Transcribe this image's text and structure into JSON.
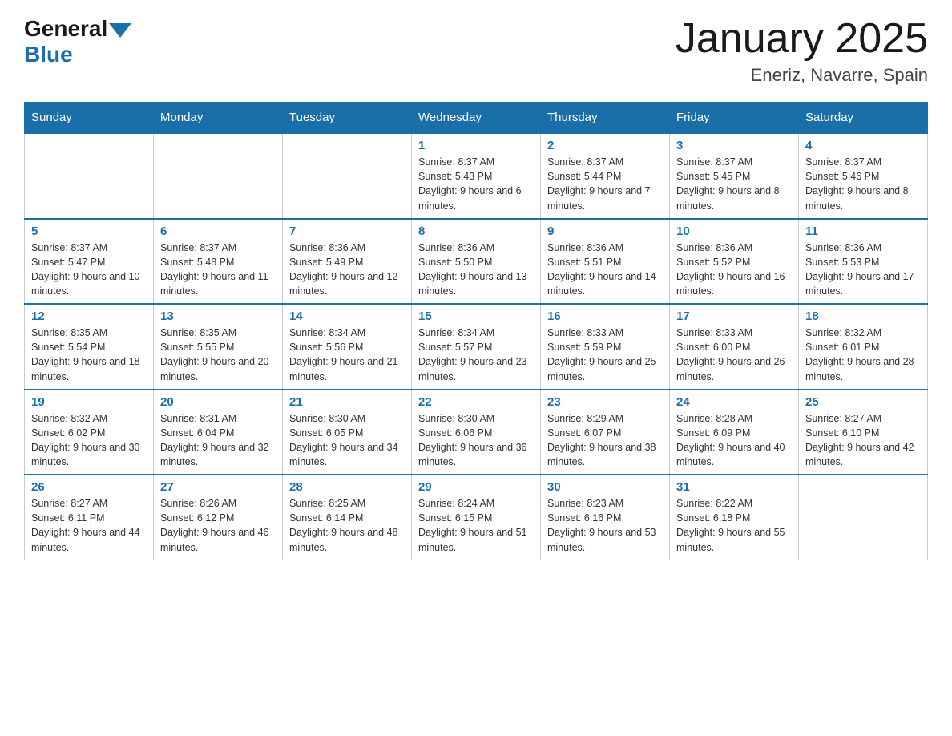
{
  "header": {
    "logo_general": "General",
    "logo_blue": "Blue",
    "month_title": "January 2025",
    "location": "Eneriz, Navarre, Spain"
  },
  "days_of_week": [
    "Sunday",
    "Monday",
    "Tuesday",
    "Wednesday",
    "Thursday",
    "Friday",
    "Saturday"
  ],
  "weeks": [
    [
      {
        "day": "",
        "info": ""
      },
      {
        "day": "",
        "info": ""
      },
      {
        "day": "",
        "info": ""
      },
      {
        "day": "1",
        "info": "Sunrise: 8:37 AM\nSunset: 5:43 PM\nDaylight: 9 hours and 6 minutes."
      },
      {
        "day": "2",
        "info": "Sunrise: 8:37 AM\nSunset: 5:44 PM\nDaylight: 9 hours and 7 minutes."
      },
      {
        "day": "3",
        "info": "Sunrise: 8:37 AM\nSunset: 5:45 PM\nDaylight: 9 hours and 8 minutes."
      },
      {
        "day": "4",
        "info": "Sunrise: 8:37 AM\nSunset: 5:46 PM\nDaylight: 9 hours and 8 minutes."
      }
    ],
    [
      {
        "day": "5",
        "info": "Sunrise: 8:37 AM\nSunset: 5:47 PM\nDaylight: 9 hours and 10 minutes."
      },
      {
        "day": "6",
        "info": "Sunrise: 8:37 AM\nSunset: 5:48 PM\nDaylight: 9 hours and 11 minutes."
      },
      {
        "day": "7",
        "info": "Sunrise: 8:36 AM\nSunset: 5:49 PM\nDaylight: 9 hours and 12 minutes."
      },
      {
        "day": "8",
        "info": "Sunrise: 8:36 AM\nSunset: 5:50 PM\nDaylight: 9 hours and 13 minutes."
      },
      {
        "day": "9",
        "info": "Sunrise: 8:36 AM\nSunset: 5:51 PM\nDaylight: 9 hours and 14 minutes."
      },
      {
        "day": "10",
        "info": "Sunrise: 8:36 AM\nSunset: 5:52 PM\nDaylight: 9 hours and 16 minutes."
      },
      {
        "day": "11",
        "info": "Sunrise: 8:36 AM\nSunset: 5:53 PM\nDaylight: 9 hours and 17 minutes."
      }
    ],
    [
      {
        "day": "12",
        "info": "Sunrise: 8:35 AM\nSunset: 5:54 PM\nDaylight: 9 hours and 18 minutes."
      },
      {
        "day": "13",
        "info": "Sunrise: 8:35 AM\nSunset: 5:55 PM\nDaylight: 9 hours and 20 minutes."
      },
      {
        "day": "14",
        "info": "Sunrise: 8:34 AM\nSunset: 5:56 PM\nDaylight: 9 hours and 21 minutes."
      },
      {
        "day": "15",
        "info": "Sunrise: 8:34 AM\nSunset: 5:57 PM\nDaylight: 9 hours and 23 minutes."
      },
      {
        "day": "16",
        "info": "Sunrise: 8:33 AM\nSunset: 5:59 PM\nDaylight: 9 hours and 25 minutes."
      },
      {
        "day": "17",
        "info": "Sunrise: 8:33 AM\nSunset: 6:00 PM\nDaylight: 9 hours and 26 minutes."
      },
      {
        "day": "18",
        "info": "Sunrise: 8:32 AM\nSunset: 6:01 PM\nDaylight: 9 hours and 28 minutes."
      }
    ],
    [
      {
        "day": "19",
        "info": "Sunrise: 8:32 AM\nSunset: 6:02 PM\nDaylight: 9 hours and 30 minutes."
      },
      {
        "day": "20",
        "info": "Sunrise: 8:31 AM\nSunset: 6:04 PM\nDaylight: 9 hours and 32 minutes."
      },
      {
        "day": "21",
        "info": "Sunrise: 8:30 AM\nSunset: 6:05 PM\nDaylight: 9 hours and 34 minutes."
      },
      {
        "day": "22",
        "info": "Sunrise: 8:30 AM\nSunset: 6:06 PM\nDaylight: 9 hours and 36 minutes."
      },
      {
        "day": "23",
        "info": "Sunrise: 8:29 AM\nSunset: 6:07 PM\nDaylight: 9 hours and 38 minutes."
      },
      {
        "day": "24",
        "info": "Sunrise: 8:28 AM\nSunset: 6:09 PM\nDaylight: 9 hours and 40 minutes."
      },
      {
        "day": "25",
        "info": "Sunrise: 8:27 AM\nSunset: 6:10 PM\nDaylight: 9 hours and 42 minutes."
      }
    ],
    [
      {
        "day": "26",
        "info": "Sunrise: 8:27 AM\nSunset: 6:11 PM\nDaylight: 9 hours and 44 minutes."
      },
      {
        "day": "27",
        "info": "Sunrise: 8:26 AM\nSunset: 6:12 PM\nDaylight: 9 hours and 46 minutes."
      },
      {
        "day": "28",
        "info": "Sunrise: 8:25 AM\nSunset: 6:14 PM\nDaylight: 9 hours and 48 minutes."
      },
      {
        "day": "29",
        "info": "Sunrise: 8:24 AM\nSunset: 6:15 PM\nDaylight: 9 hours and 51 minutes."
      },
      {
        "day": "30",
        "info": "Sunrise: 8:23 AM\nSunset: 6:16 PM\nDaylight: 9 hours and 53 minutes."
      },
      {
        "day": "31",
        "info": "Sunrise: 8:22 AM\nSunset: 6:18 PM\nDaylight: 9 hours and 55 minutes."
      },
      {
        "day": "",
        "info": ""
      }
    ]
  ]
}
